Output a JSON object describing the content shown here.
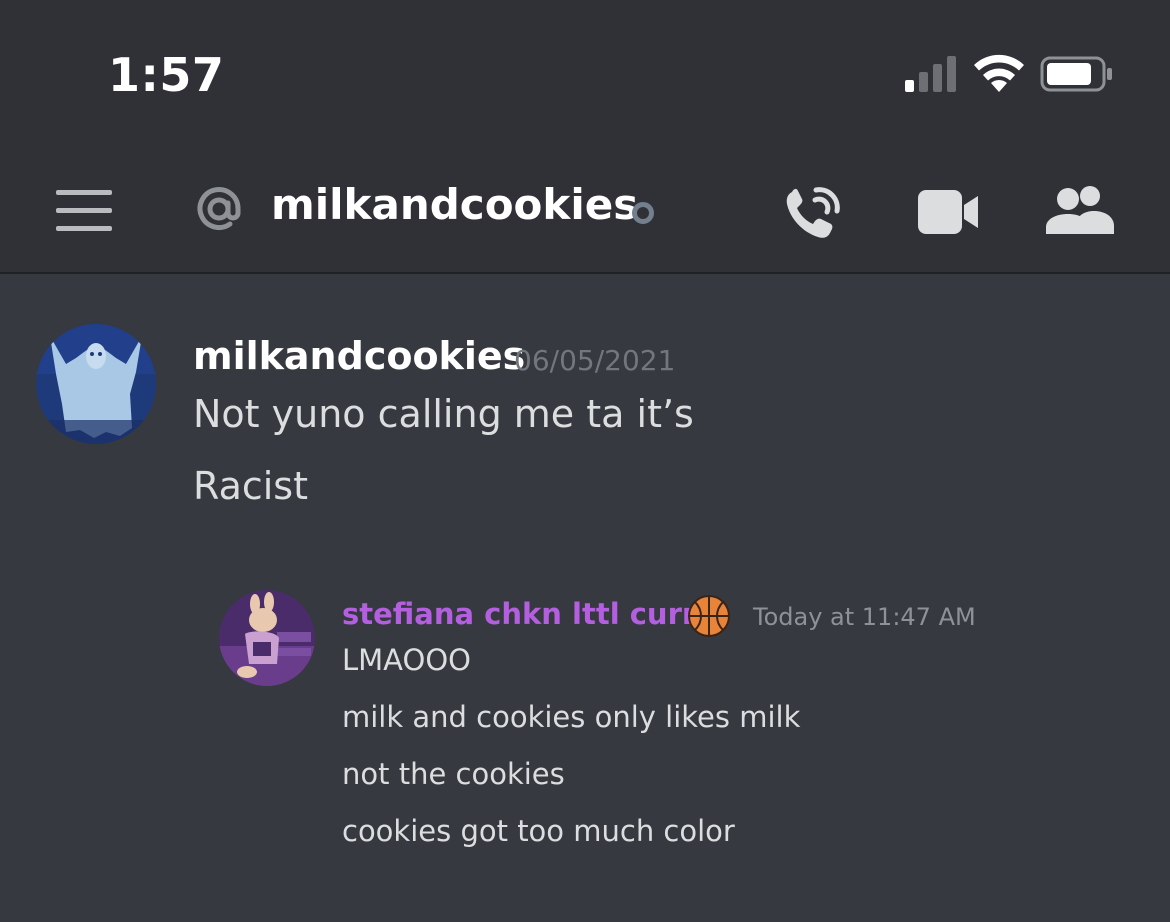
{
  "status_bar": {
    "time": "1:57",
    "signal_icon": "cellular-signal-icon",
    "wifi_icon": "wifi-icon",
    "battery_icon": "battery-icon"
  },
  "header": {
    "menu_icon": "hamburger-menu-icon",
    "at_icon": "at-sign-icon",
    "channel_name": "milkandcookies",
    "status": "offline",
    "call_icon": "voice-call-icon",
    "video_icon": "video-camera-icon",
    "members_icon": "members-icon"
  },
  "message": {
    "author": "milkandcookies",
    "timestamp": "06/05/2021",
    "lines": [
      "Not yuno calling me ta it’s",
      "Racist"
    ]
  },
  "quoted_message": {
    "author": "stefiana chkn lttl curry",
    "badge_icon": "basketball-emoji",
    "timestamp": "Today at 11:47 AM",
    "lines": [
      "LMAOOO",
      "milk and cookies only likes milk",
      "not the cookies",
      "cookies got too much color"
    ]
  },
  "colors": {
    "background": "#36393f",
    "header_background": "#2f3136",
    "quoted_author": "#b45fe0",
    "timestamp": "#72767d"
  }
}
